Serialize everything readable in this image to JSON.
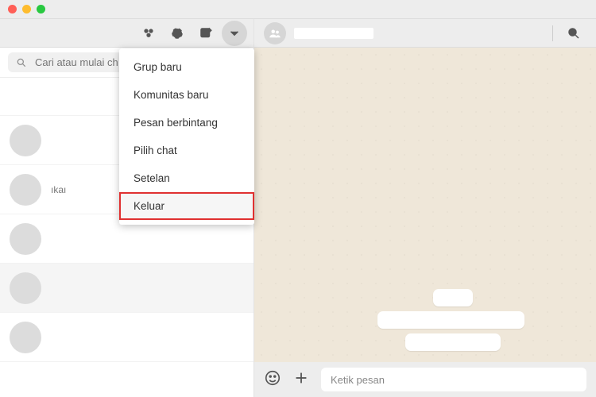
{
  "search": {
    "placeholder": "Cari atau mulai ch"
  },
  "dropdown": {
    "items": [
      {
        "label": "Grup baru"
      },
      {
        "label": "Komunitas baru"
      },
      {
        "label": "Pesan berbintang"
      },
      {
        "label": "Pilih chat"
      },
      {
        "label": "Setelan"
      },
      {
        "label": "Keluar"
      }
    ],
    "highlighted_index": 5
  },
  "chat_preview_text": "ıkaı",
  "composer": {
    "placeholder": "Ketik pesan"
  }
}
